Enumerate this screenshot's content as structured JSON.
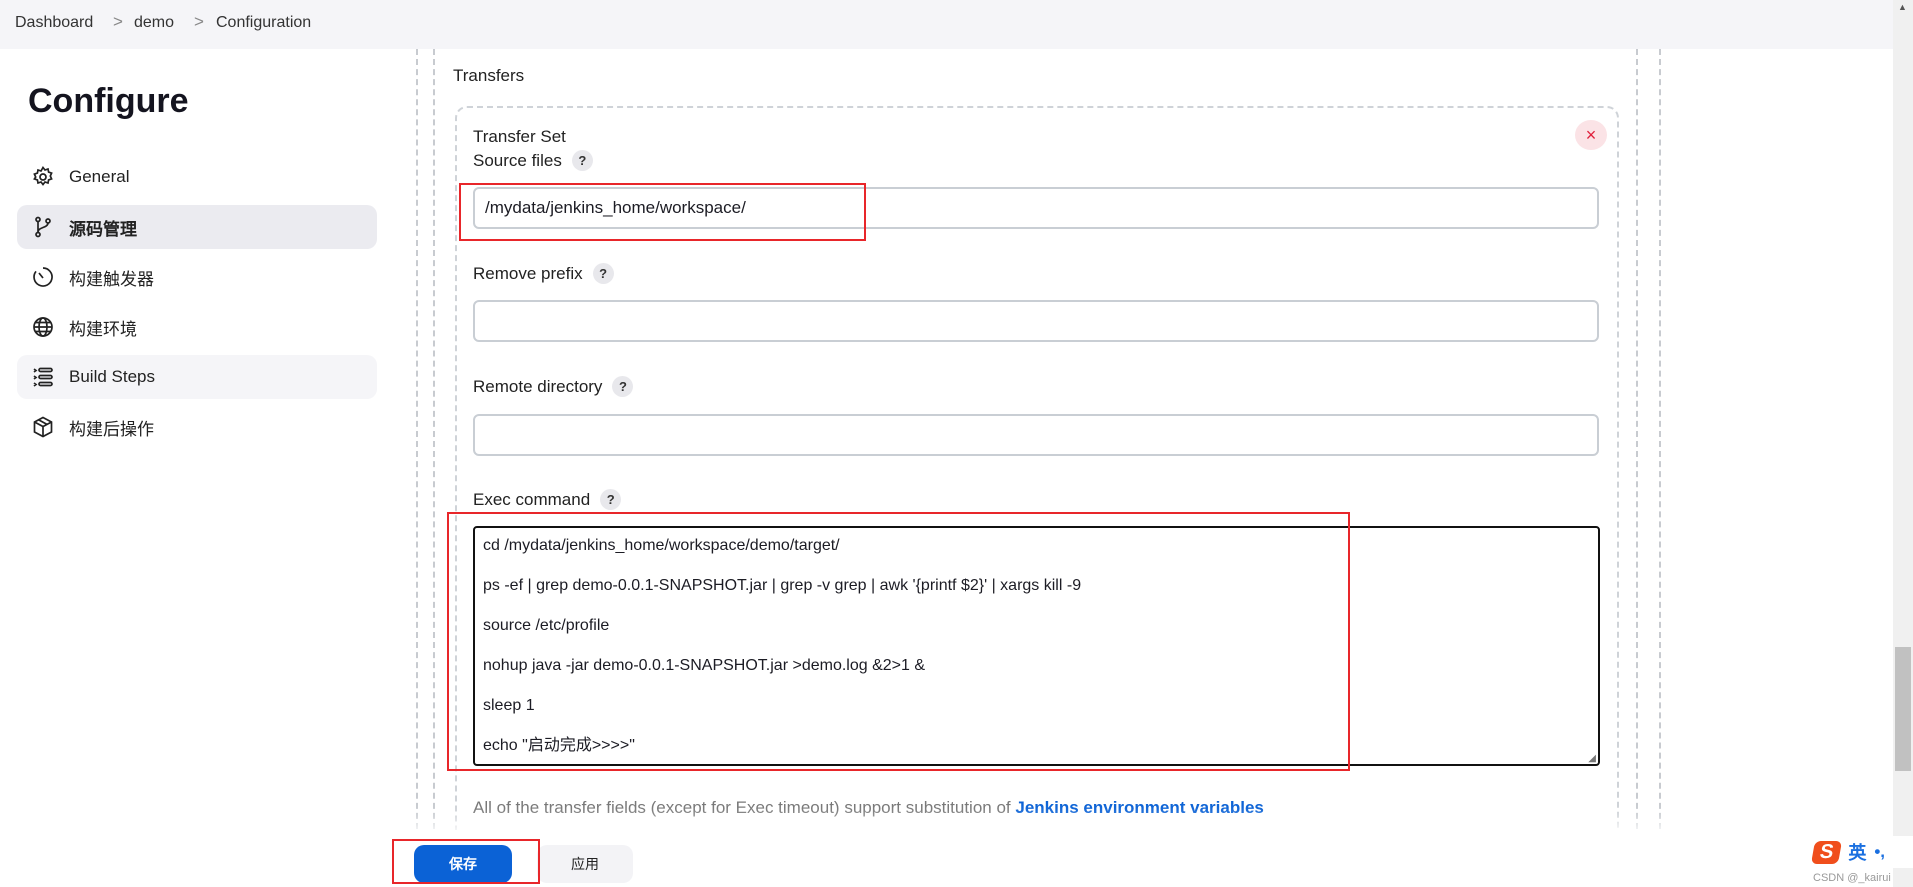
{
  "breadcrumb": [
    "Dashboard",
    "demo",
    "Configuration"
  ],
  "breadcrumb_separator": ">",
  "page_title": "Configure",
  "sidebar": {
    "items": [
      {
        "label": "General",
        "icon": "gear-icon"
      },
      {
        "label": "源码管理",
        "icon": "branch-icon",
        "active": true
      },
      {
        "label": "构建触发器",
        "icon": "timer-icon"
      },
      {
        "label": "构建环境",
        "icon": "globe-icon"
      },
      {
        "label": "Build Steps",
        "icon": "list-icon"
      },
      {
        "label": "构建后操作",
        "icon": "package-icon"
      }
    ]
  },
  "transfers": {
    "section_label": "Transfers",
    "set_title": "Transfer Set",
    "help": "?",
    "source_files": {
      "label": "Source files",
      "value": "/mydata/jenkins_home/workspace/"
    },
    "remove_prefix": {
      "label": "Remove prefix",
      "value": ""
    },
    "remote_directory": {
      "label": "Remote directory",
      "value": ""
    },
    "exec_command": {
      "label": "Exec command",
      "lines": [
        "cd /mydata/jenkins_home/workspace/demo/target/",
        "ps -ef | grep demo-0.0.1-SNAPSHOT.jar | grep -v grep | awk '{printf $2}' | xargs kill -9",
        "source /etc/profile",
        "nohup java -jar demo-0.0.1-SNAPSHOT.jar >demo.log &2>1 &",
        "sleep 1",
        "echo \"启动完成>>>>\""
      ]
    },
    "help_text": "All of the transfer fields (except for Exec timeout) support substitution of ",
    "help_link": "Jenkins environment variables"
  },
  "buttons": {
    "save": "保存",
    "apply": "应用"
  },
  "colors": {
    "primary": "#0b62d6",
    "highlight": "#e8262a",
    "link": "#0b62d6"
  },
  "ime": {
    "label": "英",
    "punct": "•,"
  },
  "watermark": "CSDN @_kairui"
}
